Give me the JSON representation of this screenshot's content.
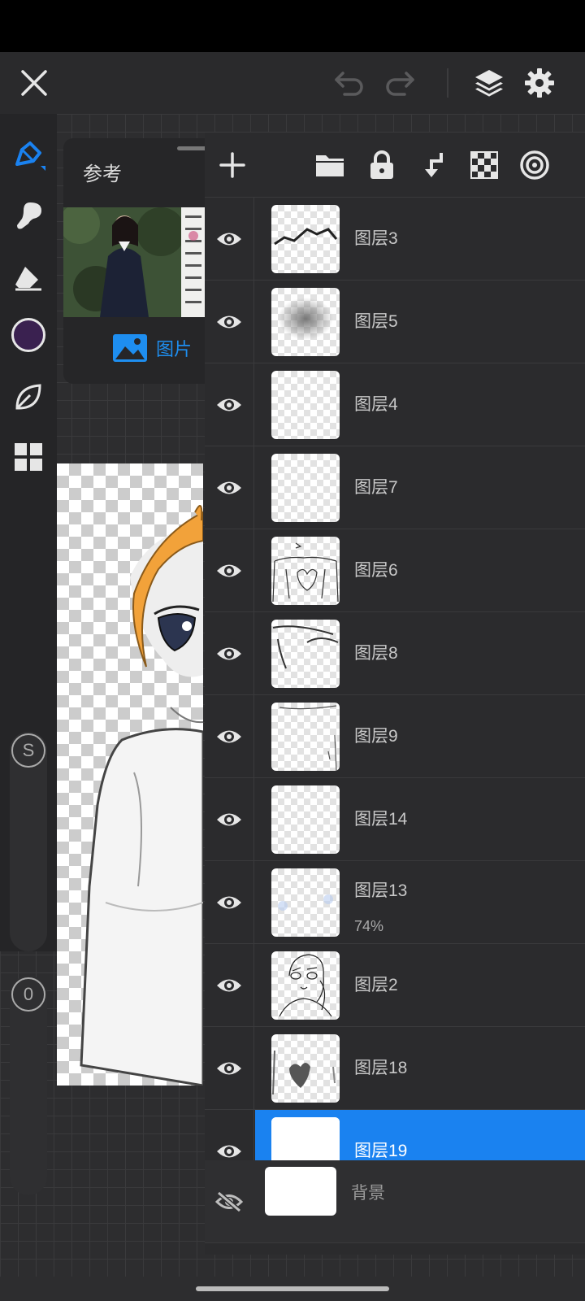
{
  "reference": {
    "title": "参考",
    "image_label": "图片"
  },
  "layers": [
    {
      "name": "图层3",
      "visible": true,
      "opacity": ""
    },
    {
      "name": "图层5",
      "visible": true,
      "opacity": ""
    },
    {
      "name": "图层4",
      "visible": true,
      "opacity": ""
    },
    {
      "name": "图层7",
      "visible": true,
      "opacity": ""
    },
    {
      "name": "图层6",
      "visible": true,
      "opacity": ""
    },
    {
      "name": "图层8",
      "visible": true,
      "opacity": ""
    },
    {
      "name": "图层9",
      "visible": true,
      "opacity": ""
    },
    {
      "name": "图层14",
      "visible": true,
      "opacity": ""
    },
    {
      "name": "图层13",
      "visible": true,
      "opacity": "74%"
    },
    {
      "name": "图层2",
      "visible": true,
      "opacity": ""
    },
    {
      "name": "图层18",
      "visible": true,
      "opacity": ""
    },
    {
      "name": "图层19",
      "visible": true,
      "opacity": "",
      "selected": true
    }
  ],
  "background_layer": {
    "name": "背景",
    "visible": false
  },
  "toolbar": {
    "brush_size_label": "S",
    "opacity_label": "0",
    "current_color": "#3a2150"
  },
  "colors": {
    "accent": "#1a82f0",
    "panel": "#2b2b2d"
  }
}
